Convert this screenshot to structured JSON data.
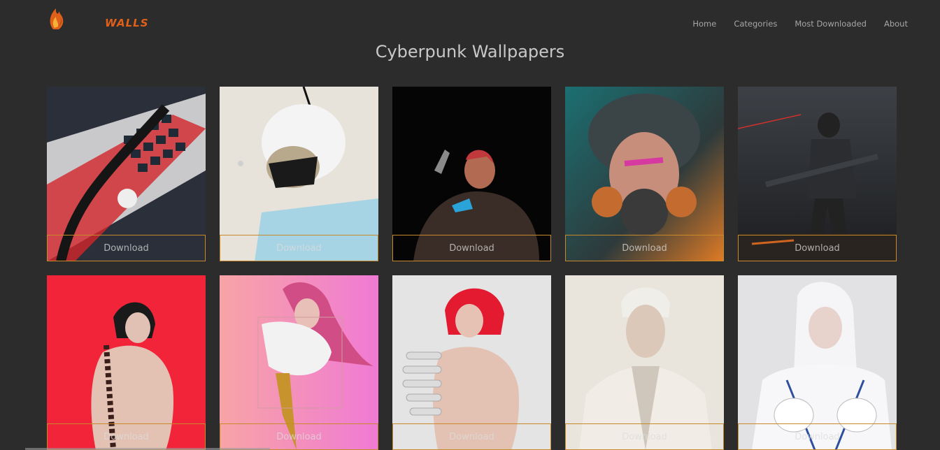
{
  "header": {
    "logo_text": "WALLS",
    "nav": [
      "Home",
      "Categories",
      "Most Downloaded",
      "About"
    ]
  },
  "page": {
    "title": "Cyberpunk Wallpapers"
  },
  "cards": [
    {
      "subject": "keyboard",
      "download_label": "Download"
    },
    {
      "subject": "mask-woman",
      "download_label": "Download"
    },
    {
      "subject": "gunner",
      "download_label": "Download"
    },
    {
      "subject": "gasmask",
      "download_label": "Download"
    },
    {
      "subject": "soldier",
      "download_label": "Download"
    },
    {
      "subject": "red-spine",
      "download_label": "Download"
    },
    {
      "subject": "pink-hair",
      "download_label": "Download"
    },
    {
      "subject": "white-spine",
      "download_label": "Download"
    },
    {
      "subject": "white-man",
      "download_label": "Download"
    },
    {
      "subject": "white-android",
      "download_label": "Download"
    }
  ],
  "colors": {
    "background": "#2c2c2c",
    "accent": "#c8892a",
    "logo": "#e0601a"
  }
}
